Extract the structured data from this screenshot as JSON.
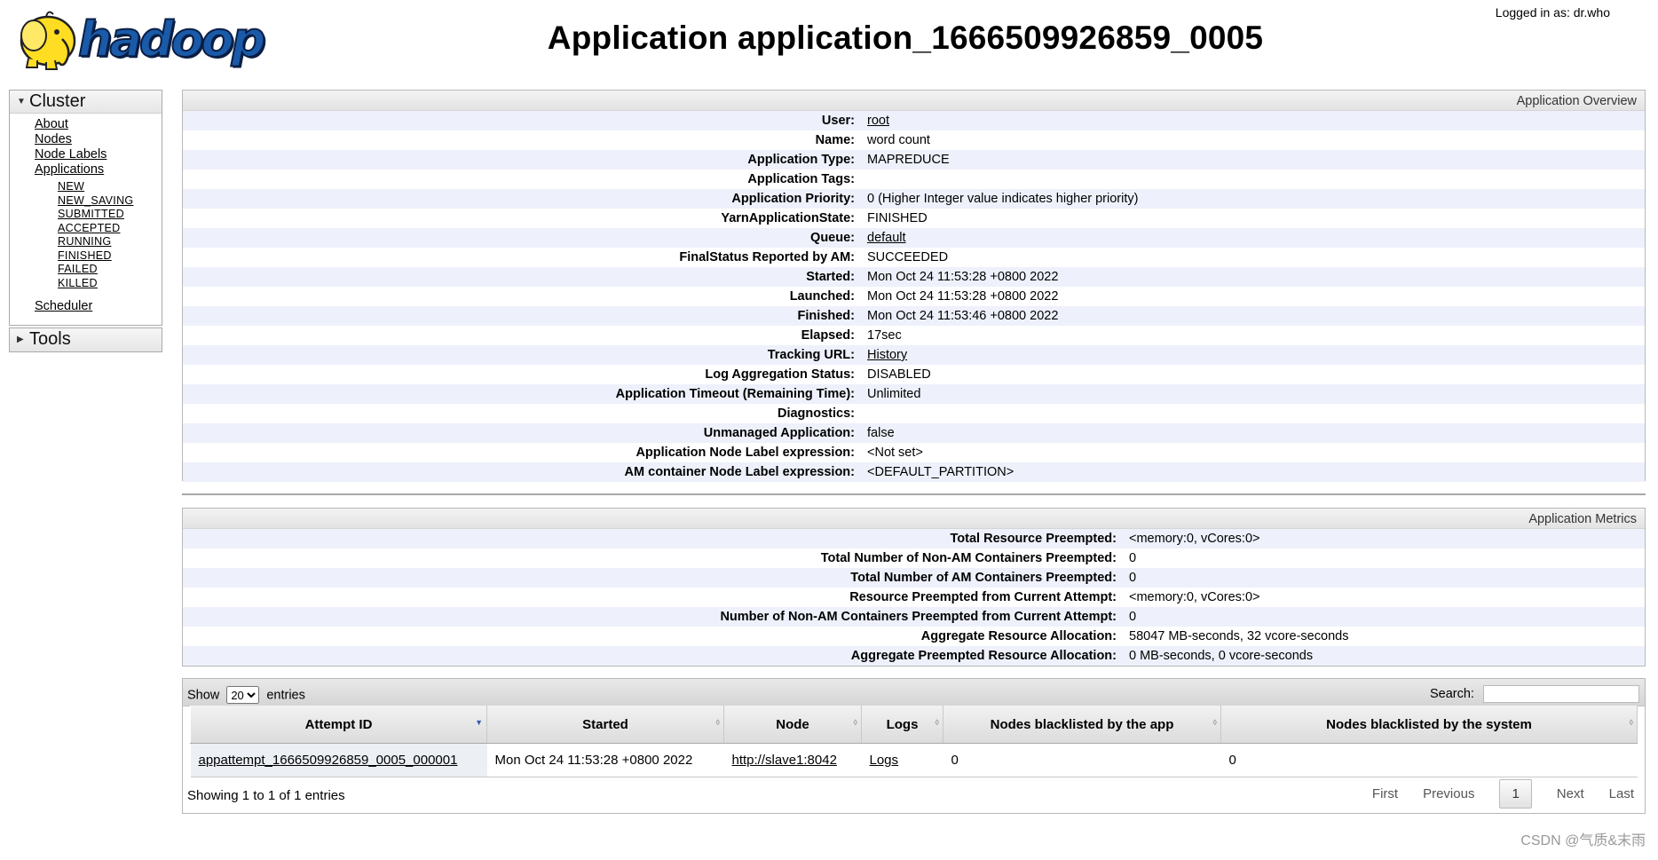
{
  "header": {
    "logo_text": "hadoop",
    "title": "Application application_1666509926859_0005",
    "logged_in": "Logged in as: dr.who"
  },
  "sidebar": {
    "cluster_label": "Cluster",
    "cluster_items": [
      "About",
      "Nodes",
      "Node Labels",
      "Applications"
    ],
    "app_states": [
      "NEW",
      "NEW_SAVING",
      "SUBMITTED",
      "ACCEPTED",
      "RUNNING",
      "FINISHED",
      "FAILED",
      "KILLED"
    ],
    "scheduler": "Scheduler",
    "tools_label": "Tools"
  },
  "overview": {
    "heading": "Application Overview",
    "rows": [
      {
        "key": "User:",
        "value": "root"
      },
      {
        "key": "Name:",
        "value": "word count"
      },
      {
        "key": "Application Type:",
        "value": "MAPREDUCE"
      },
      {
        "key": "Application Tags:",
        "value": ""
      },
      {
        "key": "Application Priority:",
        "value": "0 (Higher Integer value indicates higher priority)"
      },
      {
        "key": "YarnApplicationState:",
        "value": "FINISHED"
      },
      {
        "key": "Queue:",
        "value": "default"
      },
      {
        "key": "FinalStatus Reported by AM:",
        "value": "SUCCEEDED"
      },
      {
        "key": "Started:",
        "value": "Mon Oct 24 11:53:28 +0800 2022"
      },
      {
        "key": "Launched:",
        "value": "Mon Oct 24 11:53:28 +0800 2022"
      },
      {
        "key": "Finished:",
        "value": "Mon Oct 24 11:53:46 +0800 2022"
      },
      {
        "key": "Elapsed:",
        "value": "17sec"
      },
      {
        "key": "Tracking URL:",
        "value": "History"
      },
      {
        "key": "Log Aggregation Status:",
        "value": "DISABLED"
      },
      {
        "key": "Application Timeout (Remaining Time):",
        "value": "Unlimited"
      },
      {
        "key": "Diagnostics:",
        "value": ""
      },
      {
        "key": "Unmanaged Application:",
        "value": "false"
      },
      {
        "key": "Application Node Label expression:",
        "value": "<Not set>"
      },
      {
        "key": "AM container Node Label expression:",
        "value": "<DEFAULT_PARTITION>"
      }
    ]
  },
  "metrics": {
    "heading": "Application Metrics",
    "rows": [
      {
        "key": "Total Resource Preempted:",
        "value": "<memory:0, vCores:0>"
      },
      {
        "key": "Total Number of Non-AM Containers Preempted:",
        "value": "0"
      },
      {
        "key": "Total Number of AM Containers Preempted:",
        "value": "0"
      },
      {
        "key": "Resource Preempted from Current Attempt:",
        "value": "<memory:0, vCores:0>"
      },
      {
        "key": "Number of Non-AM Containers Preempted from Current Attempt:",
        "value": "0"
      },
      {
        "key": "Aggregate Resource Allocation:",
        "value": "58047 MB-seconds, 32 vcore-seconds"
      },
      {
        "key": "Aggregate Preempted Resource Allocation:",
        "value": "0 MB-seconds, 0 vcore-seconds"
      }
    ]
  },
  "attempts": {
    "show_label": "Show",
    "entries_label": "entries",
    "page_size": "20",
    "search_label": "Search:",
    "search_value": "",
    "columns": [
      "Attempt ID",
      "Started",
      "Node",
      "Logs",
      "Nodes blacklisted by the app",
      "Nodes blacklisted by the system"
    ],
    "rows": [
      [
        "appattempt_1666509926859_0005_000001",
        "Mon Oct 24 11:53:28 +0800 2022",
        "http://slave1:8042",
        "Logs",
        "0",
        "0"
      ]
    ],
    "info": "Showing 1 to 1 of 1 entries",
    "pager": {
      "first": "First",
      "previous": "Previous",
      "current": "1",
      "next": "Next",
      "last": "Last"
    }
  },
  "watermark": "CSDN @气质&末雨"
}
